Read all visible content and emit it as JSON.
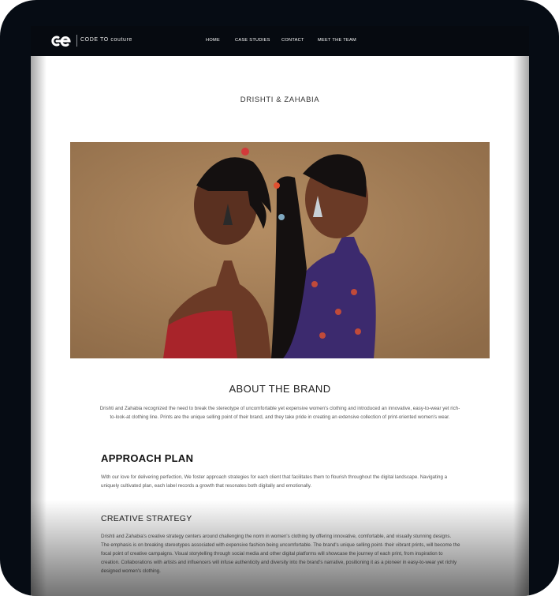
{
  "brand": {
    "logo_mark": "ce-monogram",
    "logo_text": "CODE TO couture"
  },
  "nav": {
    "items": [
      {
        "label": "HOME"
      },
      {
        "label": "CASE STUDIES"
      },
      {
        "label": "CONTACT"
      },
      {
        "label": "MEET THE TEAM"
      }
    ]
  },
  "page": {
    "title": "DRISHTI & ZAHABIA",
    "hero_image": "two-models-back-to-back-photo"
  },
  "about": {
    "heading": "ABOUT THE BRAND",
    "body": "Drishti and Zahabia recognized the need to break the stereotype of uncomfortable yet expensive women's clothing and introduced an innovative, easy-to-wear yet rich-to-look-at clothing line. Prints are the unique selling point of their brand, and they take pride in creating an extensive collection of print-oriented women's wear."
  },
  "approach": {
    "heading": "APPROACH PLAN",
    "body": "With our love for delivering perfection, We foster approach strategies for each client that facilitates them to flourish throughout the digital landscape. Navigating a uniquely cultivated plan, each label records a growth that resonates both digitally and emotionally."
  },
  "creative": {
    "heading": "CREATIVE STRATEGY",
    "body": "Drishti and Zahabia's creative strategy centers around challenging the norm in women's clothing by offering innovative, comfortable, and visually stunning designs. The emphasis is on breaking stereotypes associated with expensive fashion being uncomfortable. The brand's unique selling point- their vibrant prints, will become the focal point of creative campaigns. Visual storytelling through social media and other digital platforms will showcase the journey of each print, from inspiration to creation. Collaborations with artists and influencers will infuse authenticity and diversity into the brand's narrative, positioning it as a pioneer in easy-to-wear yet richly designed women's clothing."
  },
  "colors": {
    "frame": "#060c14",
    "nav_bg": "#060a10",
    "photo_bg": "#a8835c"
  }
}
